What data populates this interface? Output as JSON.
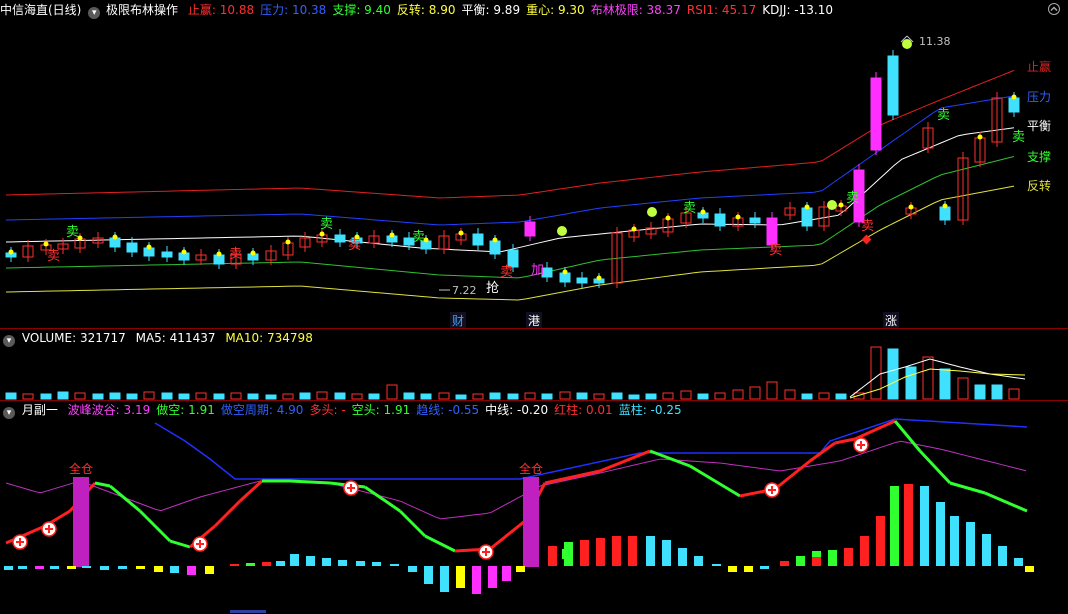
{
  "main": {
    "stock": "中信海直(日线)",
    "indicator": "极限布林操作",
    "stats": [
      {
        "label": "止赢:",
        "value": "10.88",
        "color": "#ff3030"
      },
      {
        "label": "压力:",
        "value": "10.38",
        "color": "#3060ff"
      },
      {
        "label": "支撑:",
        "value": "9.40",
        "color": "#30ff30"
      },
      {
        "label": "反转:",
        "value": "8.90",
        "color": "#ffff40"
      },
      {
        "label": "平衡:",
        "value": "9.89",
        "color": "#ffffff"
      },
      {
        "label": "重心:",
        "value": "9.30",
        "color": "#ffff40"
      },
      {
        "label": "布林极限:",
        "value": "38.37",
        "color": "#ff40ff"
      },
      {
        "label": "RSI1:",
        "value": "45.17",
        "color": "#ff3030"
      },
      {
        "label": "KDJJ:",
        "value": "-13.10",
        "color": "#ffffff"
      }
    ],
    "line_labels": {
      "zhiying": "止赢",
      "yali": "压力",
      "pingheng": "平衡",
      "zhicheng": "支撑",
      "fanzhuan": "反转"
    },
    "sell_label": "卖",
    "add_label": "加",
    "grab_label": "抢",
    "high_label": "11.38",
    "low_label": "7.22",
    "events": [
      "财",
      "港",
      "涨"
    ]
  },
  "volume": {
    "title": "VOLUME:",
    "value": "321717",
    "ma5_label": "MA5:",
    "ma5": "411437",
    "ma10_label": "MA10:",
    "ma10": "734798"
  },
  "sub": {
    "title": "月副一",
    "stats": [
      {
        "label": "波峰波谷:",
        "value": "3.19",
        "color": "#ff40ff"
      },
      {
        "label": "做空:",
        "value": "1.91",
        "color": "#30ff30"
      },
      {
        "label": "做空周期:",
        "value": "4.90",
        "color": "#3060ff"
      },
      {
        "label": "多头:",
        "value": "-",
        "color": "#ff3030"
      },
      {
        "label": "空头:",
        "value": "1.91",
        "color": "#30ff30"
      },
      {
        "label": "趋线:",
        "value": "-0.55",
        "color": "#3060ff"
      },
      {
        "label": "中线:",
        "value": "-0.20",
        "color": "#ffffff"
      },
      {
        "label": "红柱:",
        "value": "0.01",
        "color": "#ff3030"
      },
      {
        "label": "蓝柱:",
        "value": "-0.25",
        "color": "#40e0ff"
      }
    ],
    "full_position_label": "全仓"
  },
  "colors": {
    "up": "#ff3030",
    "down": "#40e0ff",
    "magenta": "#ff30ff",
    "yellow": "#ffff00",
    "green": "#30ff30",
    "blue": "#2030ff",
    "bg": "#000000"
  }
}
